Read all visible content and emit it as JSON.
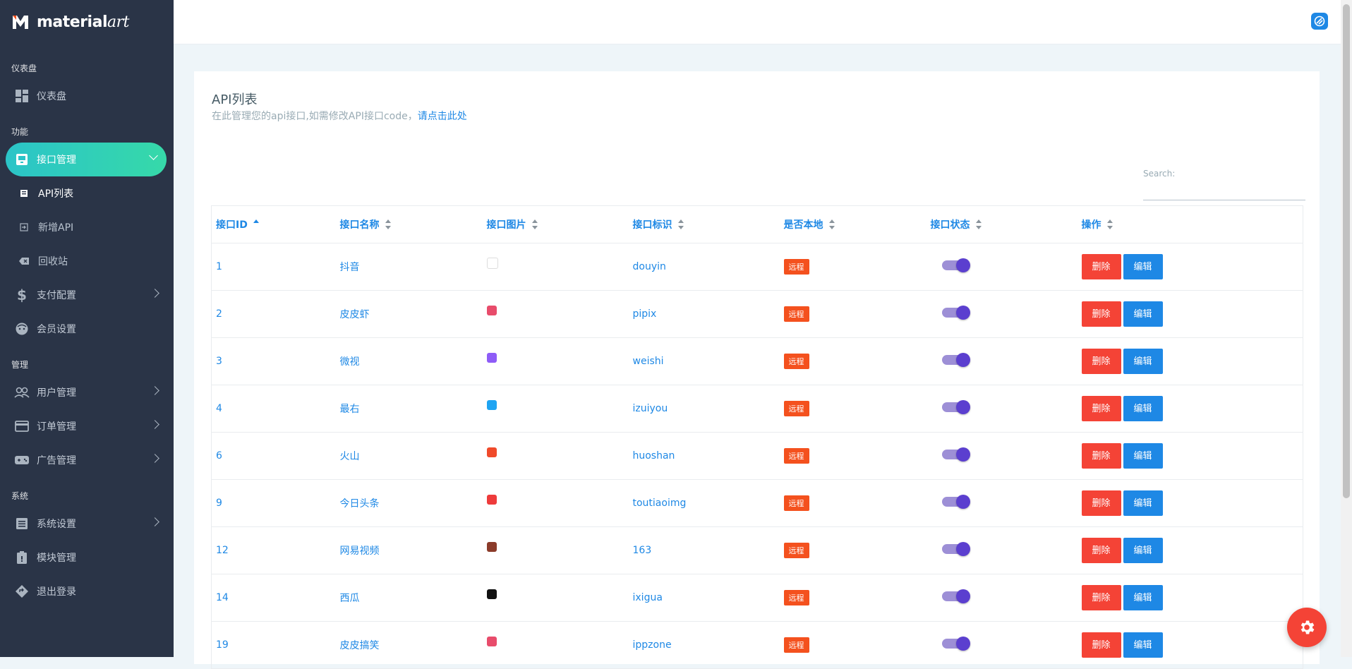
{
  "app": {
    "name_main": "material",
    "name_art": "art"
  },
  "sidebar": {
    "captions": [
      "仪表盘",
      "功能",
      "管理",
      "系统"
    ],
    "dashboard": {
      "label": "仪表盘",
      "icon": "dashboard-icon"
    },
    "api_mgmt": {
      "label": "接口管理",
      "icon": "inbox-icon"
    },
    "subs": [
      {
        "label": "API列表",
        "icon": "list-icon"
      },
      {
        "label": "新增API",
        "icon": "login-icon"
      },
      {
        "label": "回收站",
        "icon": "backspace-icon"
      }
    ],
    "pay": {
      "label": "支付配置",
      "icon": "dollar-icon"
    },
    "member": {
      "label": "会员设置",
      "icon": "face-icon"
    },
    "user": {
      "label": "用户管理",
      "icon": "users-icon"
    },
    "order": {
      "label": "订单管理",
      "icon": "card-icon"
    },
    "ad": {
      "label": "广告管理",
      "icon": "gamepad-icon"
    },
    "sys": {
      "label": "系统设置",
      "icon": "settings-list-icon"
    },
    "module": {
      "label": "模块管理",
      "icon": "module-icon"
    },
    "logout": {
      "label": "退出登录",
      "icon": "logout-icon"
    }
  },
  "page": {
    "title": "API列表",
    "subtitle_prefix": "在此管理您的api接口,如需修改API接口code，",
    "subtitle_link": "请点击此处",
    "search_label": "Search:"
  },
  "table": {
    "headers": [
      "接口ID",
      "接口名称",
      "接口图片",
      "接口标识",
      "是否本地",
      "接口状态",
      "操作"
    ],
    "rows": [
      {
        "id": "1",
        "name": "抖音",
        "code": "douyin",
        "local": "远程",
        "color": "#ffffff"
      },
      {
        "id": "2",
        "name": "皮皮虾",
        "code": "pipix",
        "local": "远程",
        "color": "#e84c6b"
      },
      {
        "id": "3",
        "name": "微视",
        "code": "weishi",
        "local": "远程",
        "color": "#8e5cf7"
      },
      {
        "id": "4",
        "name": "最右",
        "code": "izuiyou",
        "local": "远程",
        "color": "#1fa4f2"
      },
      {
        "id": "6",
        "name": "火山",
        "code": "huoshan",
        "local": "远程",
        "color": "#f04a2a"
      },
      {
        "id": "9",
        "name": "今日头条",
        "code": "toutiaoimg",
        "local": "远程",
        "color": "#ee3b3b"
      },
      {
        "id": "12",
        "name": "网易视频",
        "code": "163",
        "local": "远程",
        "color": "#8b3b2a"
      },
      {
        "id": "14",
        "name": "西瓜",
        "code": "ixigua",
        "local": "远程",
        "color": "#111111"
      },
      {
        "id": "19",
        "name": "皮皮搞笑",
        "code": "ippzone",
        "local": "远程",
        "color": "#e84c6b"
      }
    ],
    "delete_label": "删除",
    "edit_label": "编辑"
  },
  "colors": {
    "sidebar": "#2a3447",
    "accent": "#1e88e5",
    "danger": "#f44336",
    "active_start": "#2bc4c8",
    "active_end": "#36d9a9"
  }
}
